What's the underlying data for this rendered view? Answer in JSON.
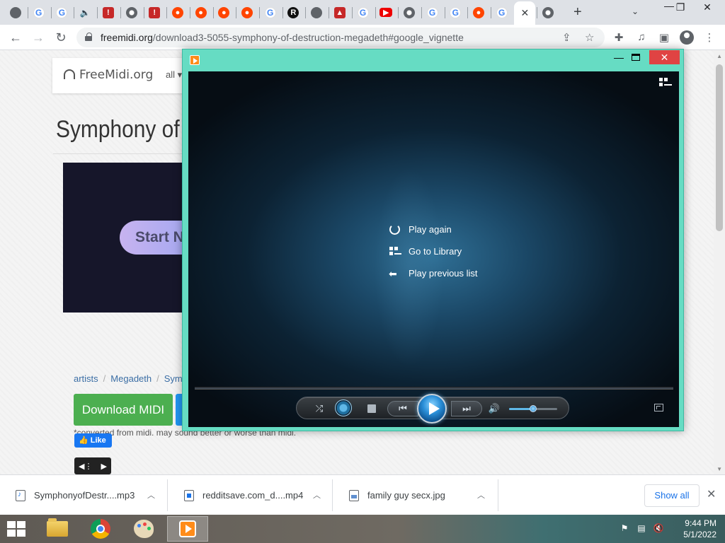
{
  "browser": {
    "tabs": [
      {
        "icon": "globe-icon",
        "glyph": ""
      },
      {
        "icon": "google-icon",
        "glyph": "G"
      },
      {
        "icon": "google-icon",
        "glyph": "G"
      },
      {
        "icon": "speaker-icon",
        "glyph": "🔈"
      },
      {
        "icon": "red-thumb-icon",
        "glyph": "!"
      },
      {
        "icon": "chrome-icon",
        "glyph": ""
      },
      {
        "icon": "red-thumb-icon",
        "glyph": "!"
      },
      {
        "icon": "reddit-icon",
        "glyph": "●"
      },
      {
        "icon": "reddit-icon",
        "glyph": "●"
      },
      {
        "icon": "reddit-icon",
        "glyph": "●"
      },
      {
        "icon": "reddit-icon",
        "glyph": "●"
      },
      {
        "icon": "google-icon",
        "glyph": "G"
      },
      {
        "icon": "r-icon",
        "glyph": "R"
      },
      {
        "icon": "globe-icon",
        "glyph": ""
      },
      {
        "icon": "red-badge-icon",
        "glyph": "▲"
      },
      {
        "icon": "google-icon",
        "glyph": "G"
      },
      {
        "icon": "youtube-icon",
        "glyph": "▶"
      },
      {
        "icon": "chrome-icon",
        "glyph": ""
      },
      {
        "icon": "google-icon",
        "glyph": "G"
      },
      {
        "icon": "google-icon",
        "glyph": "G"
      },
      {
        "icon": "reddit-icon",
        "glyph": "●"
      },
      {
        "icon": "google-icon",
        "glyph": "G"
      },
      {
        "icon": "close-icon",
        "glyph": "✕",
        "active": true
      },
      {
        "icon": "chrome-icon",
        "glyph": ""
      }
    ],
    "new_tab_glyph": "+",
    "url_host": "freemidi.org",
    "url_path": "/download3-5055-symphony-of-destruction-megadeth#google_vignette"
  },
  "site": {
    "logo": "FreeMidi.org",
    "nav": "all",
    "title": "Symphony of",
    "ad_button": "Start N",
    "breadcrumb": {
      "artists": "artists",
      "artist": "Megadeth",
      "song": "Sym"
    },
    "download_midi": "Download MIDI",
    "note": "*converted from midi. may sound better or worse than midi.",
    "like": "Like"
  },
  "downloads": {
    "items": [
      {
        "name": "SymphonyofDestr....mp3",
        "type": "audio"
      },
      {
        "name": "redditsave.com_d....mp4",
        "type": "video"
      },
      {
        "name": "family guy secx.jpg",
        "type": "image"
      }
    ],
    "show_all": "Show all"
  },
  "media_player": {
    "menu": {
      "play_again": "Play again",
      "go_to_library": "Go to Library",
      "play_previous": "Play previous list"
    },
    "volume": 0.5,
    "accent": "#66dcc3"
  },
  "taskbar": {
    "time": "9:44 PM",
    "date": "5/1/2022"
  }
}
